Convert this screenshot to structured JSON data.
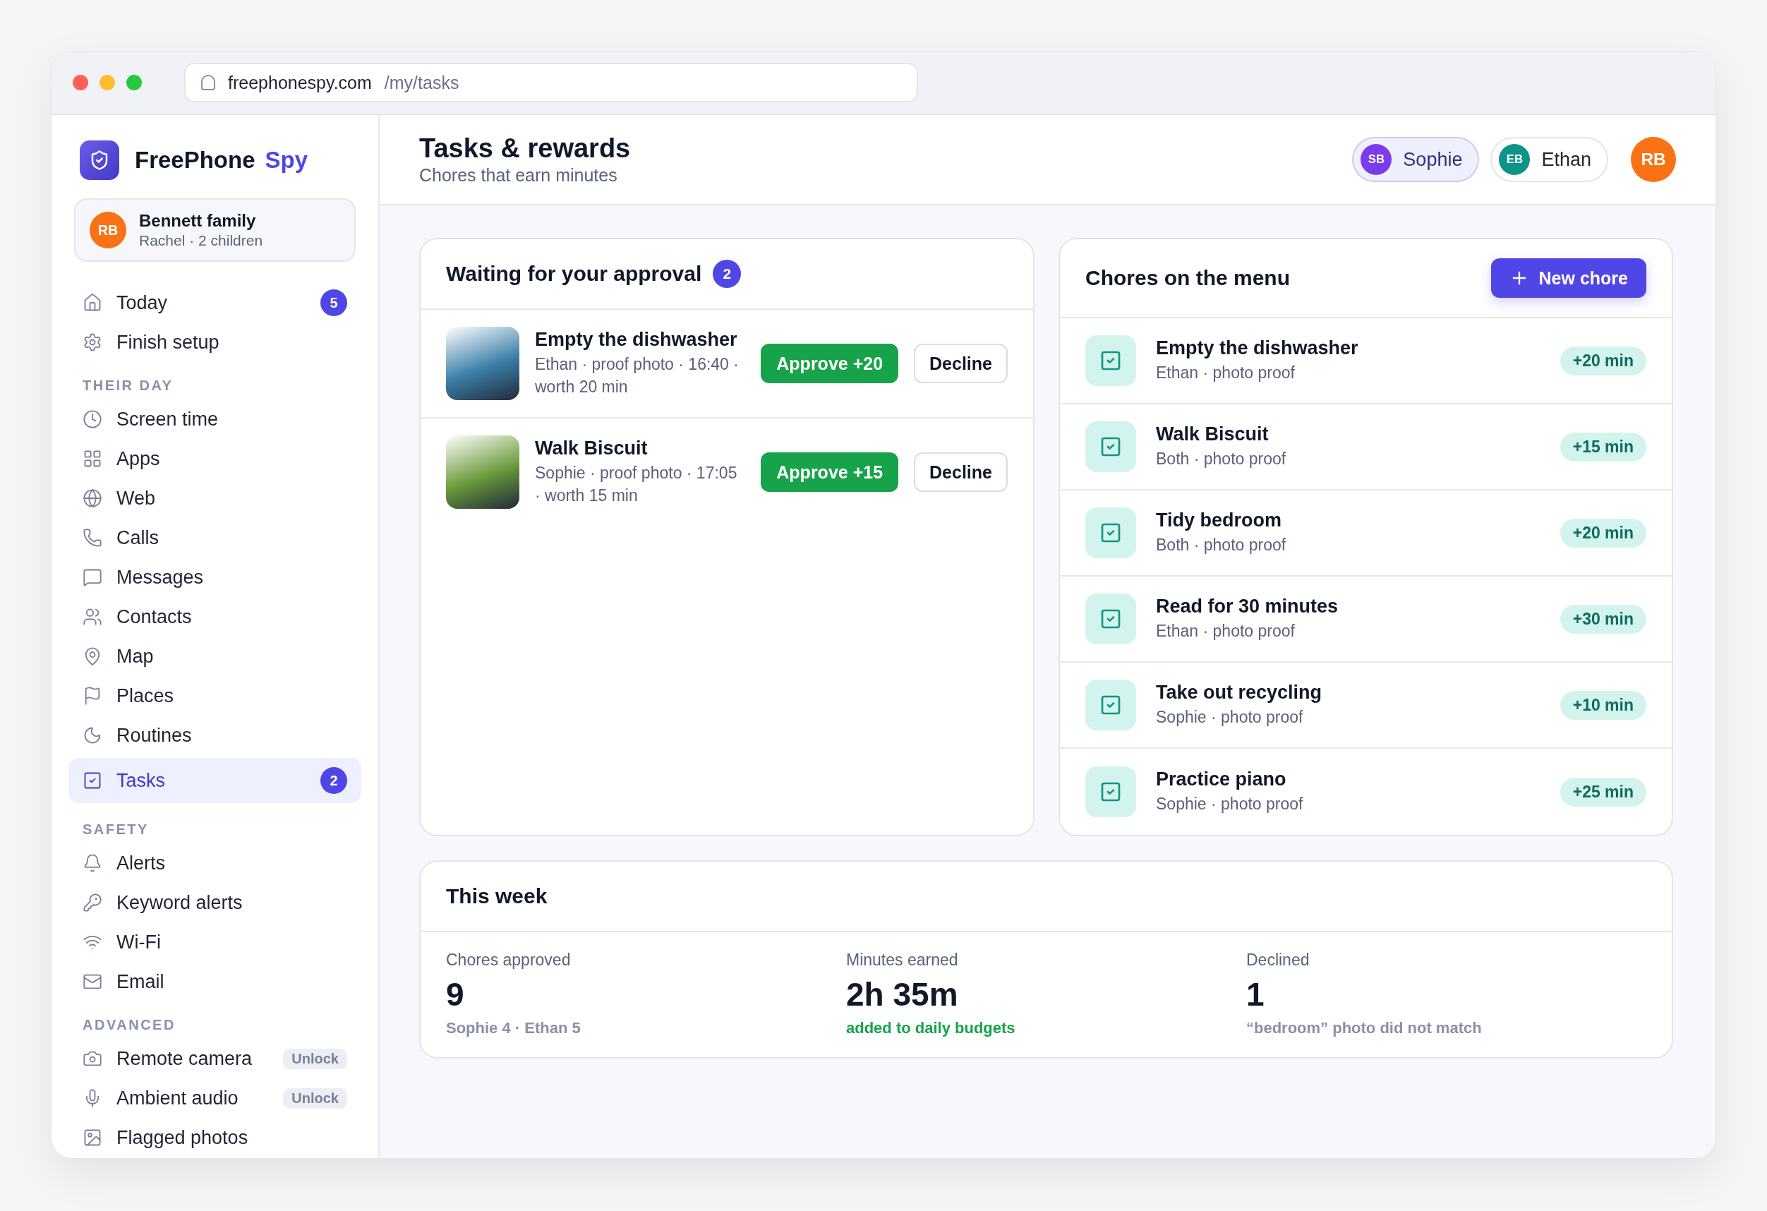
{
  "browser": {
    "domain": "freephonespy.com",
    "path": "/my/tasks"
  },
  "sidebar": {
    "brand": {
      "name": "FreePhone",
      "accent": "Spy"
    },
    "account": {
      "initials": "RB",
      "name": "Bennett family",
      "detail": "Rachel · 2 children"
    },
    "sections": [
      {
        "items": [
          {
            "label": "Today",
            "kind": "home",
            "badge": "5",
            "selected": false
          },
          {
            "label": "Finish setup",
            "kind": "gear",
            "selected": false
          }
        ]
      },
      {
        "title": "THEIR DAY",
        "items": [
          {
            "label": "Screen time",
            "kind": "clock",
            "selected": false
          },
          {
            "label": "Apps",
            "kind": "grid",
            "selected": false
          },
          {
            "label": "Web",
            "kind": "globe",
            "selected": false
          },
          {
            "label": "Calls",
            "kind": "phone",
            "selected": false
          },
          {
            "label": "Messages",
            "kind": "message",
            "selected": false
          },
          {
            "label": "Contacts",
            "kind": "users",
            "selected": false
          },
          {
            "label": "Map",
            "kind": "pin",
            "selected": false
          },
          {
            "label": "Places",
            "kind": "flag",
            "selected": false
          },
          {
            "label": "Routines",
            "kind": "moon",
            "selected": false
          },
          {
            "label": "Tasks",
            "kind": "check",
            "badge": "2",
            "selected": true
          }
        ]
      },
      {
        "title": "SAFETY",
        "items": [
          {
            "label": "Alerts",
            "kind": "bell",
            "selected": false
          },
          {
            "label": "Keyword alerts",
            "kind": "key",
            "selected": false
          },
          {
            "label": "Wi-Fi",
            "kind": "wifi",
            "selected": false
          },
          {
            "label": "Email",
            "kind": "mail",
            "selected": false
          }
        ]
      },
      {
        "title": "ADVANCED",
        "items": [
          {
            "label": "Remote camera",
            "kind": "camera",
            "tag": "Unlock",
            "selected": false
          },
          {
            "label": "Ambient audio",
            "kind": "mic",
            "tag": "Unlock",
            "selected": false
          },
          {
            "label": "Flagged photos",
            "kind": "image",
            "selected": false
          }
        ]
      }
    ]
  },
  "header": {
    "title": "Tasks & rewards",
    "subtitle": "Chores that earn minutes",
    "children": [
      {
        "initials": "SB",
        "name": "Sophie",
        "color": "#7c3aed",
        "selected": true
      },
      {
        "initials": "EB",
        "name": "Ethan",
        "color": "#0d9488",
        "selected": false
      }
    ],
    "user_initials": "RB"
  },
  "approval": {
    "title": "Waiting for your approval",
    "count": "2",
    "items": [
      {
        "title": "Empty the dishwasher",
        "detail": "Ethan · proof photo · 16:40 · worth 20 min",
        "approve": "Approve +20",
        "decline": "Decline",
        "color": "#3b7fa8"
      },
      {
        "title": "Walk Biscuit",
        "detail": "Sophie · proof photo · 17:05 · worth 15 min",
        "approve": "Approve +15",
        "decline": "Decline",
        "color": "#6b9a3a"
      }
    ]
  },
  "chores": {
    "title": "Chores on the menu",
    "button": "New chore",
    "items": [
      {
        "title": "Empty the dishwasher",
        "detail": "Ethan · photo proof",
        "reward": "+20 min"
      },
      {
        "title": "Walk Biscuit",
        "detail": "Both · photo proof",
        "reward": "+15 min"
      },
      {
        "title": "Tidy bedroom",
        "detail": "Both · photo proof",
        "reward": "+20 min"
      },
      {
        "title": "Read for 30 minutes",
        "detail": "Ethan · photo proof",
        "reward": "+30 min"
      },
      {
        "title": "Take out recycling",
        "detail": "Sophie · photo proof",
        "reward": "+10 min"
      },
      {
        "title": "Practice piano",
        "detail": "Sophie · photo proof",
        "reward": "+25 min"
      }
    ]
  },
  "week": {
    "title": "This week",
    "stats": [
      {
        "label": "Chores approved",
        "value": "9",
        "note": "Sophie 4 · Ethan 5",
        "kind": "muted"
      },
      {
        "label": "Minutes earned",
        "value": "2h 35m",
        "note": "added to daily budgets",
        "kind": "positive"
      },
      {
        "label": "Declined",
        "value": "1",
        "note": "“bedroom” photo did not match",
        "kind": "muted"
      }
    ]
  }
}
